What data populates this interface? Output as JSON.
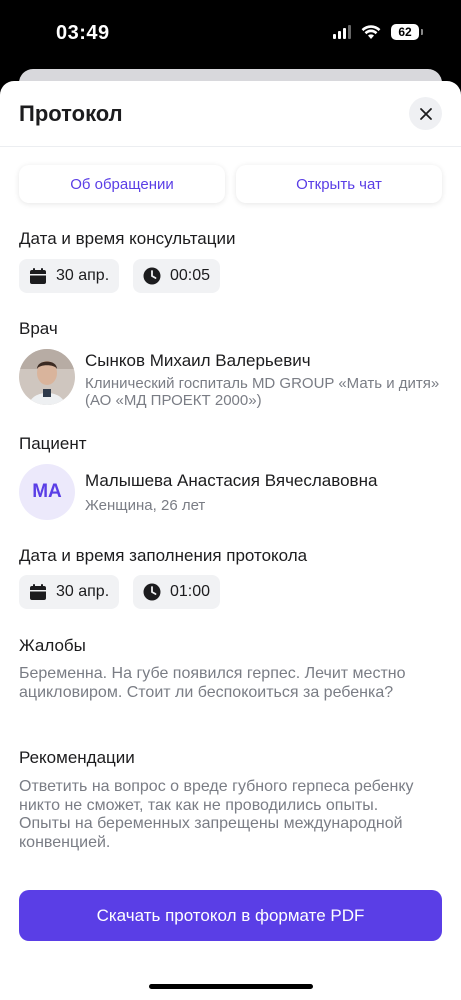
{
  "status_bar": {
    "time": "03:49",
    "battery": "62"
  },
  "sheet": {
    "title": "Протокол",
    "close_icon": "close-icon"
  },
  "tabs": [
    {
      "label": "Об обращении"
    },
    {
      "label": "Открыть чат"
    }
  ],
  "consultation": {
    "title": "Дата и время консультации",
    "date": "30 апр.",
    "time": "00:05"
  },
  "doctor": {
    "title": "Врач",
    "name": "Сынков Михаил Валерьевич",
    "clinic": "Клинический госпиталь MD GROUP «Мать и дитя» (АО «МД ПРОЕКТ 2000»)"
  },
  "patient": {
    "title": "Пациент",
    "initials": "МА",
    "name": "Малышева Анастасия Вячеславовна",
    "info": "Женщина, 26 лет"
  },
  "protocol_fill": {
    "title": "Дата и время заполнения протокола",
    "date": "30 апр.",
    "time": "01:00"
  },
  "complaints": {
    "title": "Жалобы",
    "text": "Беременна. На губе появился герпес. Лечит местно ацикловиром. Стоит ли беспокоиться за ребенка?"
  },
  "recommendations": {
    "title": "Рекомендации",
    "text": "Ответить на вопрос о вреде губного герпеса ребенку никто не сможет, так как не проводились опыты. Опыты на беременных запрещены международной конвенцией."
  },
  "download_button": {
    "label": "Скачать протокол в формате PDF"
  },
  "colors": {
    "accent": "#5a3ee6",
    "chip_bg": "#f1f2f4",
    "muted_text": "#7a7d85"
  }
}
